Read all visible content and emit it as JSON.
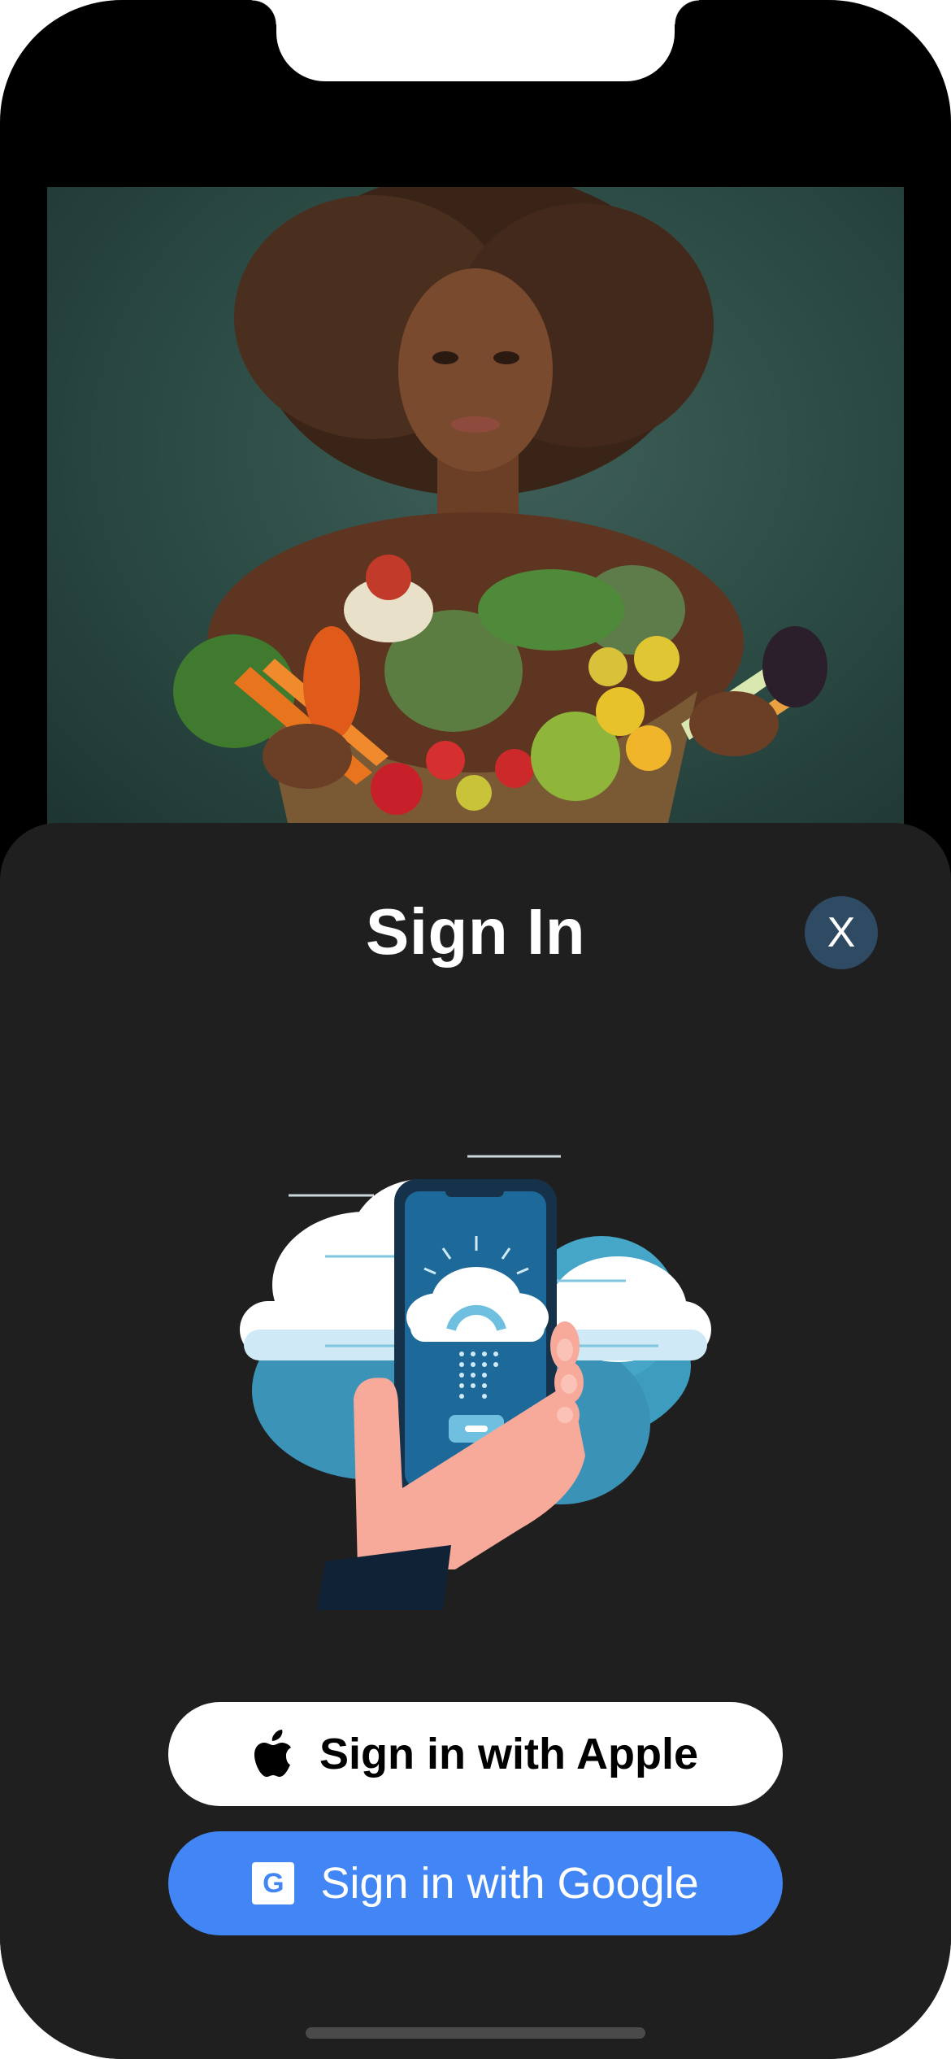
{
  "sheet": {
    "title": "Sign In",
    "close_label": "X"
  },
  "buttons": {
    "apple_label": "Sign in with Apple",
    "google_label": "Sign in with Google",
    "google_glyph": "G"
  },
  "icons": {
    "close": "close-icon",
    "apple": "apple-logo-icon",
    "google": "google-logo-icon",
    "illustration": "phone-cloud-sync-illustration"
  },
  "colors": {
    "sheet_bg": "#1f1f1f",
    "close_bg": "#2f4b63",
    "apple_button": "#ffffff",
    "google_button": "#4285f4"
  }
}
